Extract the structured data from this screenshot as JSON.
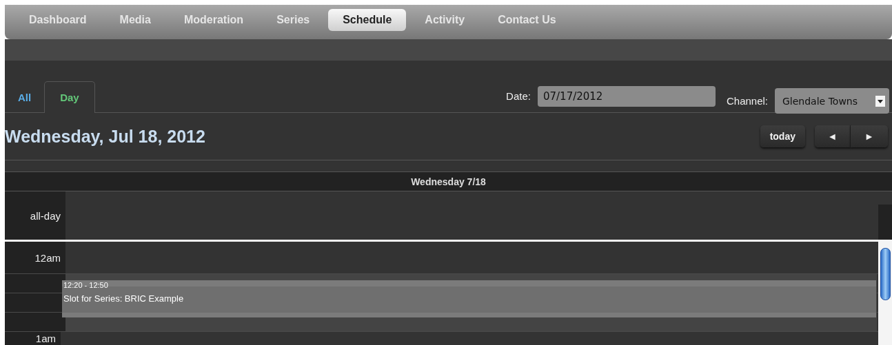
{
  "nav": [
    {
      "label": "Dashboard",
      "selected": false
    },
    {
      "label": "Media",
      "selected": false
    },
    {
      "label": "Moderation",
      "selected": false
    },
    {
      "label": "Series",
      "selected": false
    },
    {
      "label": "Schedule",
      "selected": true
    },
    {
      "label": "Activity",
      "selected": false
    },
    {
      "label": "Contact Us",
      "selected": false
    }
  ],
  "view_tabs": [
    {
      "label": "All",
      "selected": false
    },
    {
      "label": "Day",
      "selected": true
    }
  ],
  "date_field": {
    "label": "Date:",
    "value": "07/17/2012"
  },
  "channel_select": {
    "label": "Channel:",
    "value": "Glendale Towns"
  },
  "calendar": {
    "title": "Wednesday, Jul 18, 2012",
    "today_button": "today",
    "prev_button": "◄",
    "next_button": "►",
    "day_header": "Wednesday 7/18",
    "all_day_label": "all-day",
    "time_rows": [
      {
        "label": "12am"
      },
      {},
      {},
      {},
      {
        "label": "1am"
      }
    ],
    "events": [
      {
        "time": "12:20 - 12:50",
        "title": "Slot for Series: BRIC Example"
      }
    ]
  }
}
